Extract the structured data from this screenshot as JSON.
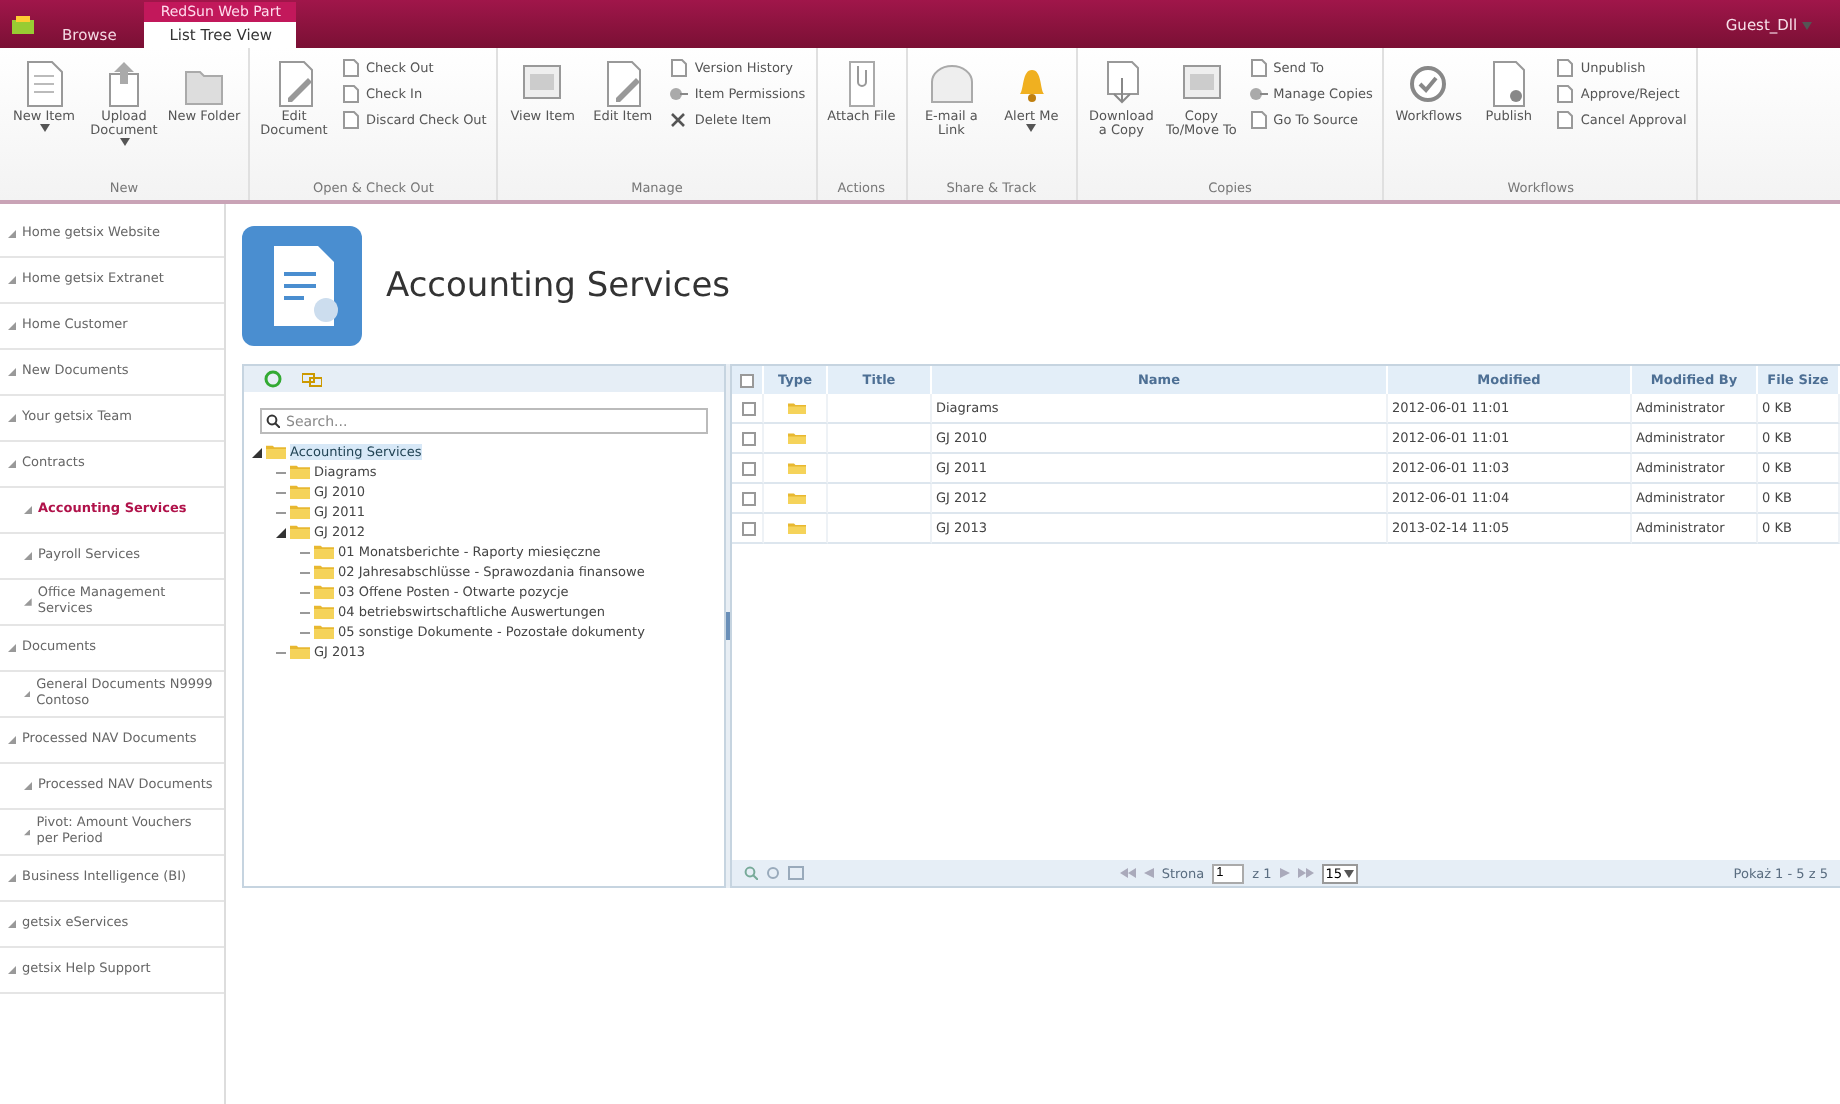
{
  "header": {
    "tabs": [
      {
        "label": "Browse",
        "selected": false
      },
      {
        "label": "List Tree View",
        "selected": true,
        "context": "RedSun Web Part"
      }
    ],
    "user": "Guest_Dll"
  },
  "ribbon": [
    {
      "label": "New",
      "large": [
        {
          "label": "New Item",
          "dropdown": true
        },
        {
          "label": "Upload Document",
          "dropdown": true
        },
        {
          "label": "New Folder",
          "dropdown": false
        }
      ]
    },
    {
      "label": "Open & Check Out",
      "large": [
        {
          "label": "Edit Document",
          "dropdown": false
        }
      ],
      "small": [
        {
          "label": "Check Out"
        },
        {
          "label": "Check In"
        },
        {
          "label": "Discard Check Out"
        }
      ]
    },
    {
      "label": "Manage",
      "large": [
        {
          "label": "View Item",
          "dropdown": false
        },
        {
          "label": "Edit Item",
          "dropdown": false
        }
      ],
      "small": [
        {
          "label": "Version History"
        },
        {
          "label": "Item Permissions"
        },
        {
          "label": "Delete Item"
        }
      ]
    },
    {
      "label": "Actions",
      "large": [
        {
          "label": "Attach File",
          "dropdown": false
        }
      ]
    },
    {
      "label": "Share & Track",
      "large": [
        {
          "label": "E-mail a Link",
          "dropdown": false
        },
        {
          "label": "Alert Me",
          "dropdown": true
        }
      ]
    },
    {
      "label": "Copies",
      "large": [
        {
          "label": "Download a Copy",
          "dropdown": false
        },
        {
          "label": "Copy To/Move To",
          "dropdown": false
        }
      ],
      "small": [
        {
          "label": "Send To"
        },
        {
          "label": "Manage Copies"
        },
        {
          "label": "Go To Source"
        }
      ]
    },
    {
      "label": "Workflows",
      "large": [
        {
          "label": "Workflows",
          "dropdown": false
        },
        {
          "label": "Publish",
          "dropdown": false
        }
      ],
      "small": [
        {
          "label": "Unpublish"
        },
        {
          "label": "Approve/Reject"
        },
        {
          "label": "Cancel Approval"
        }
      ]
    }
  ],
  "nav": [
    {
      "label": "Home getsix Website",
      "selected": false
    },
    {
      "label": "Home getsix Extranet",
      "selected": false
    },
    {
      "label": "Home Customer",
      "selected": false
    },
    {
      "label": "New Documents",
      "selected": false
    },
    {
      "label": "Your getsix Team",
      "selected": false
    },
    {
      "label": "Contracts",
      "selected": false,
      "children": [
        {
          "label": "Accounting Services",
          "selected": true
        },
        {
          "label": "Payroll Services",
          "selected": false
        },
        {
          "label": "Office Management Services",
          "selected": false
        }
      ]
    },
    {
      "label": "Documents",
      "selected": false,
      "children": [
        {
          "label": "General Documents N9999 Contoso",
          "selected": false
        }
      ]
    },
    {
      "label": "Processed NAV Documents",
      "selected": false,
      "children": [
        {
          "label": "Processed NAV Documents",
          "selected": false
        },
        {
          "label": "Pivot: Amount Vouchers per Period",
          "selected": false
        }
      ]
    },
    {
      "label": "Business Intelligence (BI)",
      "selected": false
    },
    {
      "label": "getsix eServices",
      "selected": false
    },
    {
      "label": "getsix Help Support",
      "selected": false
    }
  ],
  "page_title": "Accounting Services",
  "tree": {
    "search": {
      "placeholder": "Search..."
    },
    "root": {
      "label": "Accounting Services",
      "expanded": true,
      "selected": true,
      "children": [
        {
          "label": "Diagrams"
        },
        {
          "label": "GJ 2010"
        },
        {
          "label": "GJ 2011"
        },
        {
          "label": "GJ 2012",
          "expanded": true,
          "children": [
            {
              "label": "01 Monatsberichte - Raporty miesięczne"
            },
            {
              "label": "02 Jahresabschlüsse - Sprawozdania finansowe"
            },
            {
              "label": "03 Offene Posten - Otwarte pozycje"
            },
            {
              "label": "04 betriebswirtschaftliche Auswertungen"
            },
            {
              "label": "05 sonstige Dokumente - Pozostałe dokumenty"
            }
          ]
        },
        {
          "label": "GJ 2013"
        }
      ]
    }
  },
  "grid": {
    "all_checked": false,
    "columns": [
      "Type",
      "Title",
      "Name",
      "Modified",
      "Modified By",
      "File Size"
    ],
    "rows": [
      {
        "checked": false,
        "name": "Diagrams",
        "modified": "2012-06-01 11:01",
        "modified_by": "Administrator",
        "size": "0 KB"
      },
      {
        "checked": false,
        "name": "GJ 2010",
        "modified": "2012-06-01 11:01",
        "modified_by": "Administrator",
        "size": "0 KB"
      },
      {
        "checked": false,
        "name": "GJ 2011",
        "modified": "2012-06-01 11:03",
        "modified_by": "Administrator",
        "size": "0 KB"
      },
      {
        "checked": false,
        "name": "GJ 2012",
        "modified": "2012-06-01 11:04",
        "modified_by": "Administrator",
        "size": "0 KB"
      },
      {
        "checked": false,
        "name": "GJ 2013",
        "modified": "2013-02-14 11:05",
        "modified_by": "Administrator",
        "size": "0 KB"
      }
    ],
    "pager": {
      "page_label": "Strona",
      "page": "1",
      "of": "z 1",
      "page_size": "15",
      "summary": "Pokaż 1 - 5 z 5"
    }
  }
}
